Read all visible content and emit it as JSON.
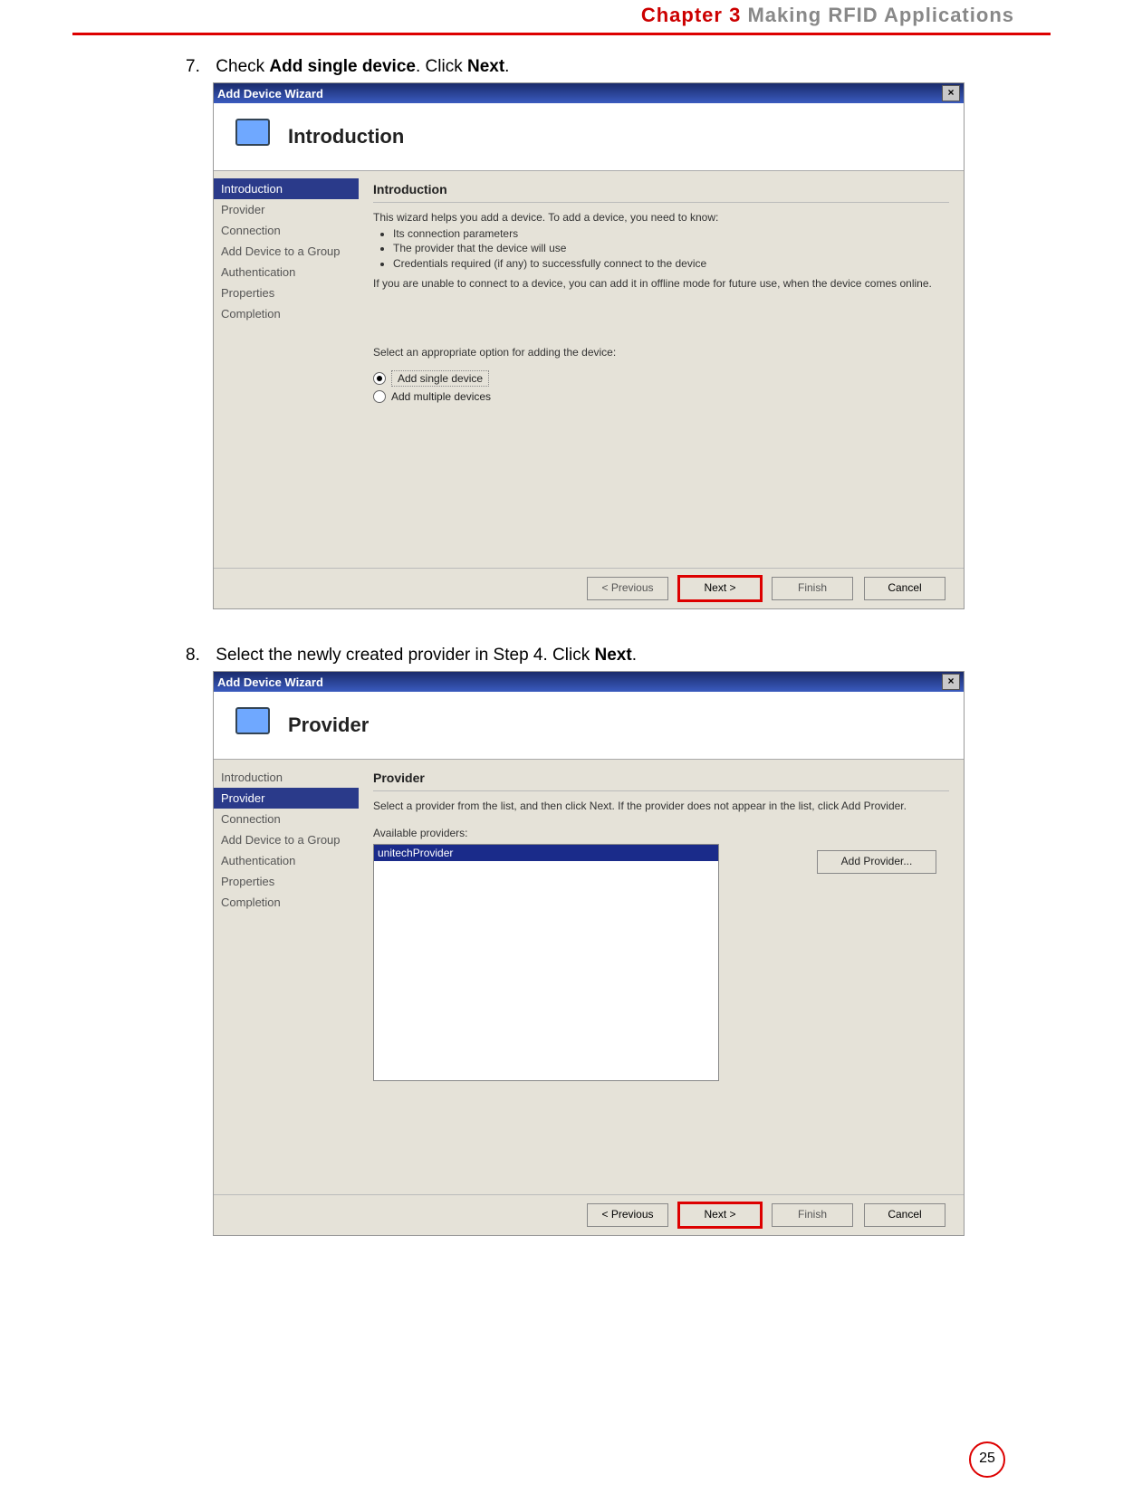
{
  "chapter": {
    "red": "Chapter 3",
    "gray": "  Making RFID Applications"
  },
  "step7": {
    "num": "7.",
    "before": "Check ",
    "bold1": "Add single device",
    "mid": ". Click ",
    "bold2": "Next",
    "after": "."
  },
  "step8": {
    "num": "8.",
    "before": "Select the newly created provider in Step 4. Click ",
    "bold1": "Next",
    "after": "."
  },
  "wizard1": {
    "window_title": "Add Device Wizard",
    "header_title": "Introduction",
    "nav": [
      "Introduction",
      "Provider",
      "Connection",
      "Add Device to a Group",
      "Authentication",
      "Properties",
      "Completion"
    ],
    "nav_active_index": 0,
    "section_title": "Introduction",
    "intro_line": "This wizard helps you add a device. To add a device, you need to know:",
    "bullets": [
      "Its connection parameters",
      "The provider that the device will use",
      "Credentials required (if any) to successfully connect to the device"
    ],
    "offline_line": "If you are unable to connect to a device, you can add it in offline mode for future use, when the device comes online.",
    "select_line": "Select an appropriate option for adding the device:",
    "opt1": "Add single device",
    "opt2": "Add multiple devices",
    "buttons": {
      "back": "< Previous",
      "next": "Next >",
      "finish": "Finish",
      "cancel": "Cancel"
    }
  },
  "wizard2": {
    "window_title": "Add Device Wizard",
    "header_title": "Provider",
    "nav": [
      "Introduction",
      "Provider",
      "Connection",
      "Add Device to a Group",
      "Authentication",
      "Properties",
      "Completion"
    ],
    "nav_active_index": 1,
    "section_title": "Provider",
    "desc": "Select a provider from the list, and then click Next. If the provider does not appear in the list, click Add Provider.",
    "avail_label": "Available providers:",
    "selected_item": "unitechProvider",
    "add_btn": "Add Provider...",
    "buttons": {
      "back": "< Previous",
      "next": "Next >",
      "finish": "Finish",
      "cancel": "Cancel"
    }
  },
  "page_number": "25"
}
